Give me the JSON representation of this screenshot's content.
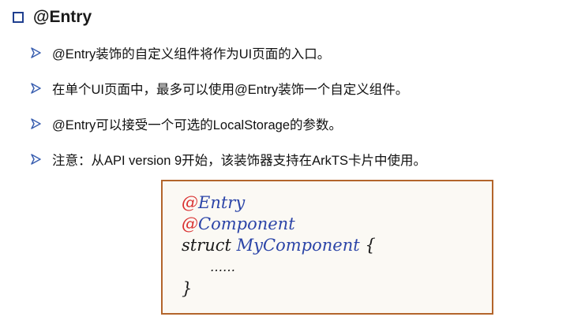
{
  "heading": {
    "text": "@Entry",
    "icon": "hollow-square-icon",
    "icon_color": "#1f3f8f"
  },
  "bullets": [
    {
      "text": "@Entry装饰的自定义组件将作为UI页面的入口。"
    },
    {
      "text": "在单个UI页面中，最多可以使用@Entry装饰一个自定义组件。"
    },
    {
      "text": "@Entry可以接受一个可选的LocalStorage的参数。"
    },
    {
      "text": "注意：从API version 9开始，该装饰器支持在ArkTS卡片中使用。"
    }
  ],
  "bullet_icon": "arrow-bullet-icon",
  "code": {
    "border_color": "#b3652b",
    "line1": {
      "at": "@",
      "name": "Entry"
    },
    "line2": {
      "at": "@",
      "name": "Component"
    },
    "line3": {
      "keyword": "struct",
      "ident": "MyComponent",
      "brace": "{"
    },
    "line4": {
      "text": "……"
    },
    "line5": {
      "text": "}"
    }
  }
}
